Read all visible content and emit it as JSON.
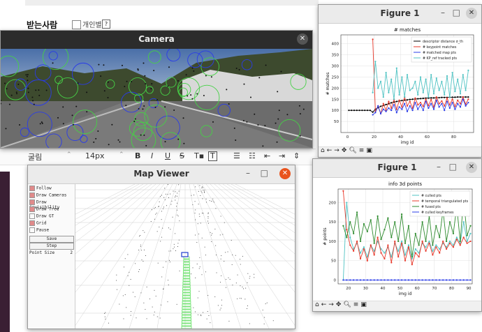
{
  "background": {
    "recipient_label": "받는사람",
    "individual_label": "개인별",
    "help_glyph": "?",
    "editor": {
      "font_family": "굴림",
      "font_size": "14px",
      "bold": "B",
      "italic": "I",
      "underline": "U",
      "strike": "S",
      "text_format": "T▪",
      "text_box": "T"
    }
  },
  "camera_window": {
    "title": "Camera"
  },
  "map_viewer": {
    "title": "Map Viewer",
    "controls": [
      {
        "label": "Follow",
        "checked": true
      },
      {
        "label": "Draw Cameras",
        "checked": true
      },
      {
        "label": "Draw Covisibility",
        "checked": true
      },
      {
        "label": "Draw Tree",
        "checked": true
      },
      {
        "label": "Draw GT",
        "checked": false
      },
      {
        "label": "Grid",
        "checked": true
      },
      {
        "label": "Pause",
        "checked": false
      }
    ],
    "save_label": "Save",
    "step_label": "Step",
    "point_size_label": "Point Size",
    "point_size_value": "2"
  },
  "figure1_top": {
    "title": "Figure 1",
    "toolbar_icons": [
      "home-icon",
      "back-icon",
      "forward-icon",
      "pan-icon",
      "zoom-icon",
      "configure-icon",
      "save-icon"
    ],
    "chart_data": {
      "type": "line",
      "title": "# matches",
      "xlabel": "img id",
      "ylabel": "# matches",
      "xlim": [
        -5,
        95
      ],
      "ylim": [
        0,
        440
      ],
      "xticks": [
        "0",
        "20",
        "40",
        "60",
        "80"
      ],
      "yticks": [
        "50",
        "100",
        "150",
        "200",
        "250",
        "300",
        "350",
        "400"
      ],
      "grid": true,
      "legend_position": "top-right",
      "x": [
        1,
        3,
        5,
        7,
        9,
        11,
        13,
        15,
        17,
        19,
        21,
        23,
        25,
        27,
        29,
        31,
        33,
        35,
        37,
        39,
        41,
        43,
        45,
        47,
        49,
        51,
        53,
        55,
        57,
        59,
        61,
        63,
        65,
        67,
        69,
        71,
        73,
        75,
        77,
        79,
        81,
        83,
        85,
        87,
        89,
        91
      ],
      "series": [
        {
          "name": "descriptor distance σ_th",
          "color": "#000000",
          "values": [
            100,
            100,
            100,
            100,
            100,
            100,
            100,
            100,
            100,
            92,
            105,
            112,
            118,
            122,
            126,
            130,
            134,
            137,
            140,
            142,
            144,
            146,
            147,
            149,
            150,
            151,
            152,
            153,
            154,
            155,
            155,
            156,
            156,
            157,
            157,
            158,
            158,
            158,
            159,
            159,
            159,
            160,
            160,
            160,
            160,
            160
          ]
        },
        {
          "name": "# keypoint matches",
          "color": "#e8382a",
          "values": [
            null,
            null,
            null,
            null,
            null,
            null,
            null,
            null,
            null,
            420,
            95,
            120,
            85,
            130,
            100,
            140,
            110,
            150,
            105,
            145,
            115,
            160,
            120,
            140,
            110,
            155,
            125,
            135,
            118,
            150,
            122,
            148,
            115,
            160,
            130,
            142,
            120,
            155,
            125,
            150,
            118,
            145,
            130,
            160,
            128,
            150
          ]
        },
        {
          "name": "# matched map pts",
          "color": "#2a3ce8",
          "values": [
            null,
            null,
            null,
            null,
            null,
            null,
            null,
            null,
            null,
            80,
            90,
            120,
            85,
            105,
            95,
            110,
            100,
            125,
            90,
            115,
            105,
            130,
            95,
            120,
            100,
            135,
            105,
            125,
            100,
            140,
            110,
            130,
            105,
            145,
            115,
            130,
            100,
            140,
            110,
            135,
            105,
            130,
            115,
            150,
            120,
            135
          ]
        },
        {
          "name": "# KP_ref tracked pts",
          "color": "#4fc3c3",
          "values": [
            null,
            null,
            null,
            null,
            null,
            null,
            null,
            null,
            null,
            180,
            320,
            200,
            230,
            160,
            270,
            180,
            240,
            150,
            290,
            170,
            250,
            160,
            260,
            190,
            200,
            230,
            170,
            250,
            180,
            240,
            160,
            260,
            175,
            245,
            190,
            230,
            170,
            255,
            160,
            270,
            185,
            240,
            175,
            260,
            190,
            280
          ]
        }
      ]
    }
  },
  "figure1_bottom": {
    "title": "Figure 1",
    "toolbar_icons": [
      "home-icon",
      "back-icon",
      "forward-icon",
      "pan-icon",
      "zoom-icon",
      "configure-icon",
      "save-icon"
    ],
    "chart_data": {
      "type": "line",
      "title": "info 3d points",
      "xlabel": "img id",
      "ylabel": "# points",
      "xlim": [
        14,
        92
      ],
      "ylim": [
        -10,
        235
      ],
      "xticks": [
        "20",
        "30",
        "40",
        "50",
        "60",
        "70",
        "80",
        "90"
      ],
      "yticks": [
        "0",
        "50",
        "100",
        "150",
        "200"
      ],
      "grid": true,
      "legend_position": "top-right",
      "x": [
        17,
        19,
        21,
        23,
        25,
        27,
        29,
        31,
        33,
        35,
        37,
        39,
        41,
        43,
        45,
        47,
        49,
        51,
        53,
        55,
        57,
        59,
        61,
        63,
        65,
        67,
        69,
        71,
        73,
        75,
        77,
        79,
        81,
        83,
        85,
        87,
        89,
        91
      ],
      "series": [
        {
          "name": "# culled pts",
          "color": "#4fc3c3",
          "values": [
            0,
            200,
            110,
            80,
            95,
            70,
            85,
            60,
            90,
            75,
            100,
            80,
            70,
            85,
            60,
            95,
            75,
            100,
            65,
            90,
            55,
            80,
            70,
            95,
            85,
            100,
            75,
            90,
            80,
            95,
            85,
            100,
            90,
            110,
            95,
            150,
            100,
            120
          ]
        },
        {
          "name": "# temporal triangulated pts",
          "color": "#e8382a",
          "values": [
            230,
            130,
            90,
            75,
            100,
            55,
            80,
            50,
            90,
            65,
            110,
            70,
            55,
            90,
            45,
            100,
            60,
            95,
            50,
            85,
            40,
            70,
            60,
            100,
            75,
            95,
            65,
            85,
            70,
            100,
            80,
            95,
            85,
            105,
            90,
            110,
            95,
            100
          ]
        },
        {
          "name": "# fused pts",
          "color": "#2e8b2e",
          "values": [
            140,
            110,
            150,
            120,
            175,
            100,
            145,
            125,
            155,
            95,
            165,
            105,
            130,
            160,
            110,
            150,
            100,
            170,
            95,
            140,
            60,
            120,
            90,
            150,
            100,
            165,
            90,
            140,
            110,
            180,
            100,
            150,
            120,
            190,
            100,
            210,
            115,
            140
          ]
        },
        {
          "name": "# culled keyframes",
          "color": "#2a3ce8",
          "values": [
            0,
            0,
            0,
            0,
            0,
            0,
            0,
            0,
            0,
            0,
            0,
            0,
            0,
            0,
            0,
            0,
            0,
            0,
            0,
            0,
            0,
            0,
            0,
            0,
            0,
            0,
            0,
            0,
            0,
            0,
            0,
            0,
            0,
            0,
            0,
            0,
            0,
            0
          ]
        }
      ]
    }
  }
}
